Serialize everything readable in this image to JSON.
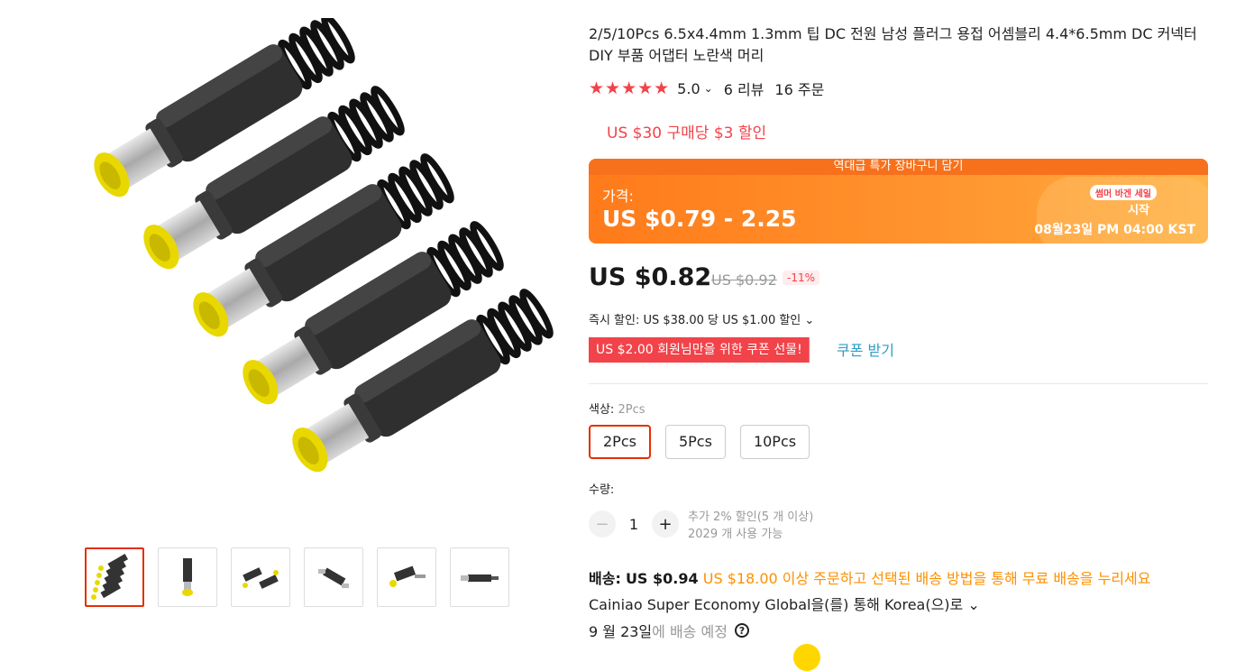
{
  "product": {
    "title": "2/5/10Pcs 6.5x4.4mm 1.3mm 팁 DC 전원 남성 플러그 용접 어셈블리 4.4*6.5mm DC 커넥터 DIY 부품 어댑터 노란색 머리",
    "stars": "★★★★★",
    "rating": "5.0",
    "rating_chevron": "⌄",
    "reviews": "6 리뷰",
    "orders": "16 주문"
  },
  "promo": {
    "text": "US $30 구매당 $3 할인"
  },
  "banner": {
    "top": "역대급 특가 장바구니 담기",
    "label": "가격:",
    "price": "US $0.79 - 2.25",
    "sale_pill": "썸머 바겐 세일",
    "start": "시작",
    "date": "08월23일 PM 04:00 KST"
  },
  "price": {
    "current": "US $0.82",
    "original": "US $0.92",
    "discount": "-11%"
  },
  "instant_discount": "즉시 할인: US $38.00 당 US $1.00 할인 ⌄",
  "coupon": {
    "pill": "US $2.00 회원님만을 위한 쿠폰 선물!",
    "link": "쿠폰 받기"
  },
  "color": {
    "label": "색상:",
    "selected": "2Pcs",
    "options": [
      "2Pcs",
      "5Pcs",
      "10Pcs"
    ]
  },
  "quantity": {
    "label": "수량:",
    "value": "1",
    "minus": "−",
    "plus": "+",
    "note1": "추가 2% 할인(5 개 이상)",
    "note2": "2029 개 사용 가능"
  },
  "shipping": {
    "label": "배송:",
    "price": "US $0.94",
    "free": "US $18.00 이상 주문하고 선택된 배송 방법을 통해 무료 배송을 누리세요",
    "method": "Cainiao Super Economy Global을(를) 통해 Korea(으)로 ⌄",
    "date": "9 월 23일",
    "date_suffix": "에 배송 예정",
    "help": "?"
  },
  "colors": {
    "accent": "#e62e04",
    "red": "#f2434a",
    "orange": "#fd9000",
    "link": "#2e9cc3"
  }
}
